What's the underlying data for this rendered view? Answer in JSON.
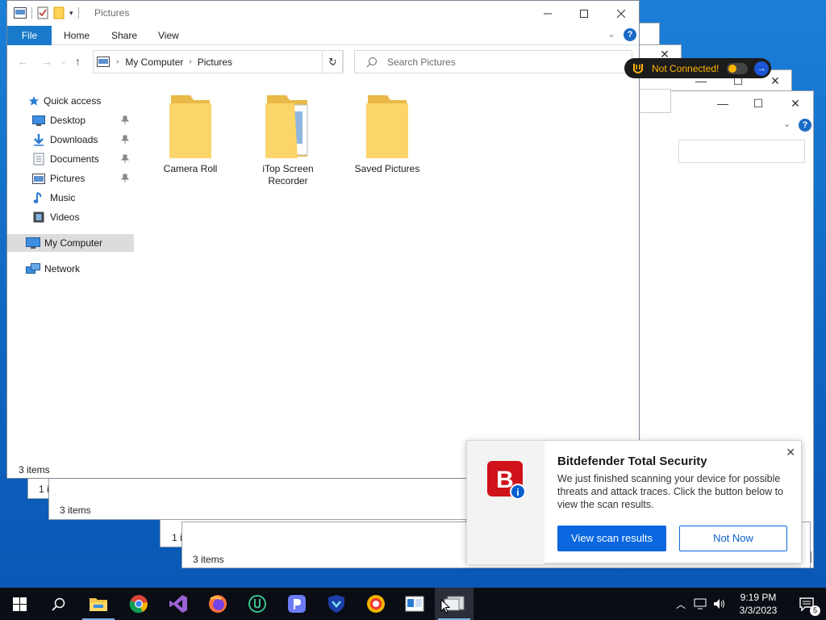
{
  "explorer": {
    "title": "Pictures",
    "tabs": {
      "file": "File",
      "home": "Home",
      "share": "Share",
      "view": "View"
    },
    "breadcrumb": [
      "My Computer",
      "Pictures"
    ],
    "search_placeholder": "Search Pictures",
    "nav": {
      "quick_access": "Quick access",
      "items": [
        "Desktop",
        "Downloads",
        "Documents",
        "Pictures",
        "Music",
        "Videos"
      ],
      "my_computer": "My Computer",
      "network": "Network"
    },
    "folders": [
      {
        "name": "Camera Roll"
      },
      {
        "name": "iTop Screen Recorder"
      },
      {
        "name": "Saved Pictures"
      }
    ],
    "status": "3 items"
  },
  "background_windows": {
    "status_1": "1 i",
    "status_2": "3 items",
    "status_3": "1 i",
    "status_4": "3 items"
  },
  "vpn": {
    "label": "Not Connected!",
    "color": "#ffb400"
  },
  "toast": {
    "title": "Bitdefender Total Security",
    "body": "We just finished scanning your device for possible threats and attack traces. Click the button below to view the scan results.",
    "primary": "View scan results",
    "secondary": "Not Now",
    "accent": "#0a67e0",
    "brand": "#d0121b",
    "logo_letter": "B"
  },
  "taskbar": {
    "time": "9:19 PM",
    "date": "3/3/2023",
    "notifications": "5"
  }
}
